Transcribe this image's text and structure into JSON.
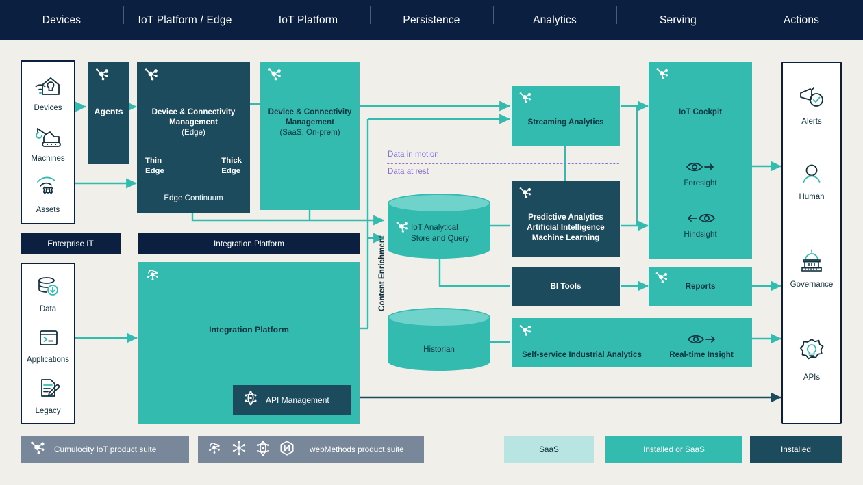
{
  "header": {
    "tabs": [
      {
        "label": "Devices"
      },
      {
        "label": "IoT Platform / Edge"
      },
      {
        "label": "IoT Platform"
      },
      {
        "label": "Persistence"
      },
      {
        "label": "Analytics"
      },
      {
        "label": "Serving"
      },
      {
        "label": "Actions"
      }
    ]
  },
  "devices_rail": {
    "items": [
      {
        "label": "Devices",
        "icon": "device-house-icon"
      },
      {
        "label": "Machines",
        "icon": "crane-machine-icon"
      },
      {
        "label": "Assets",
        "icon": "asset-gear-signal-icon"
      }
    ]
  },
  "enterprise": {
    "header_label": "Enterprise IT",
    "items": [
      {
        "label": "Data",
        "icon": "database-download-icon"
      },
      {
        "label": "Applications",
        "icon": "terminal-window-icon"
      },
      {
        "label": "Legacy",
        "icon": "document-pencil-icon"
      }
    ]
  },
  "agents": {
    "label": "Agents",
    "icon": "cumulocity-icon"
  },
  "edge": {
    "line1": "Device & Connectivity",
    "line2": "Management",
    "line3": "(Edge)",
    "thin": "Thin\nEdge",
    "thin_1": "Thin",
    "thin_2": "Edge",
    "thick_1": "Thick",
    "thick_2": "Edge",
    "continuum": "Edge Continuum",
    "icon": "cumulocity-icon"
  },
  "saas_dcm": {
    "line1": "Device & Connectivity",
    "line2": "Management",
    "line3": "(SaaS, On-prem)",
    "icon": "cumulocity-icon"
  },
  "integration": {
    "header_label": "Integration Platform",
    "body_label": "Integration Platform",
    "api_label": "API Management",
    "icon": "webmethods-cloud-icon",
    "api_icon": "webmethods-api-icon"
  },
  "persistence": {
    "data_in_motion": "Data in motion",
    "data_at_rest": "Data at rest",
    "content_enrichment": "Content Enrichment",
    "store_line1": "IoT Analytical",
    "store_line2": "Store and Query",
    "store_icon": "cumulocity-icon",
    "historian": "Historian"
  },
  "analytics": {
    "streaming": "Streaming Analytics",
    "streaming_icon": "cumulocity-icon",
    "predictive_line1": "Predictive Analytics",
    "predictive_line2": "Artificial Intelligence",
    "predictive_line3": "Machine Learning",
    "predictive_icon": "cumulocity-icon",
    "bi_tools": "BI Tools",
    "self_service": "Self-service Industrial Analytics",
    "self_service_icon": "cumulocity-icon"
  },
  "serving": {
    "cockpit": "IoT Cockpit",
    "cockpit_icon": "cumulocity-icon",
    "foresight": "Foresight",
    "foresight_icon": "eye-forward-icon",
    "hindsight": "Hindsight",
    "hindsight_icon": "eye-backward-icon",
    "reports": "Reports",
    "reports_icon": "cumulocity-icon",
    "realtime": "Real-time Insight",
    "realtime_icon": "eye-forward-icon"
  },
  "actions": {
    "items": [
      {
        "label": "Alerts",
        "icon": "megaphone-check-icon"
      },
      {
        "label": "Human",
        "icon": "person-icon"
      },
      {
        "label": "Governance",
        "icon": "capitol-building-icon"
      },
      {
        "label": "APIs",
        "icon": "gear-bulb-icon"
      }
    ]
  },
  "legend": {
    "cumulocity": "Cumulocity IoT product suite",
    "cumulocity_icon": "cumulocity-icon",
    "webmethods": "webMethods product suite",
    "webmethods_icons": [
      "webmethods-cloud-icon",
      "webmethods-hub-icon",
      "webmethods-api-icon",
      "webmethods-hex-icon"
    ],
    "swatches": [
      {
        "label": "SaaS",
        "color": "#b8e4e2"
      },
      {
        "label": "Installed or SaaS",
        "color": "#33bbb0"
      },
      {
        "label": "Installed",
        "color": "#1d4b5e"
      }
    ]
  },
  "colors": {
    "background": "#f0efe9",
    "navy": "#0b2040",
    "dark_teal": "#1d4b5e",
    "teal": "#33bbb0",
    "light_teal": "#b8e4e2",
    "purple": "#8a6fd1",
    "gray": "#78889a"
  }
}
